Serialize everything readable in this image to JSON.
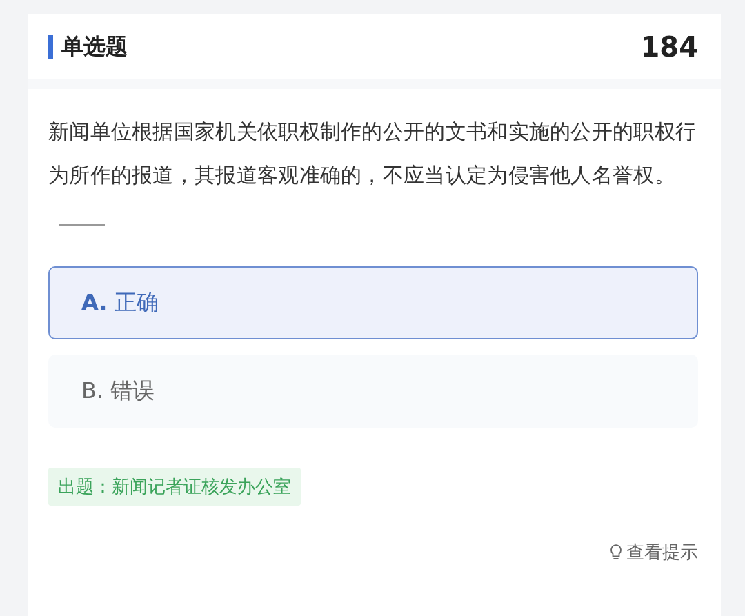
{
  "question_type": "单选题",
  "question_number": "184",
  "question": "新闻单位根据国家机关依职权制作的公开的文书和实施的公开的职权行为所作的报道，其报道客观准确的，不应当认定为侵害他人名誉权。",
  "options": [
    {
      "label": "A.",
      "text": "正确",
      "selected": true
    },
    {
      "label": "B.",
      "text": "错误",
      "selected": false
    }
  ],
  "source": "出题：新闻记者证核发办公室",
  "hint_link": "查看提示"
}
